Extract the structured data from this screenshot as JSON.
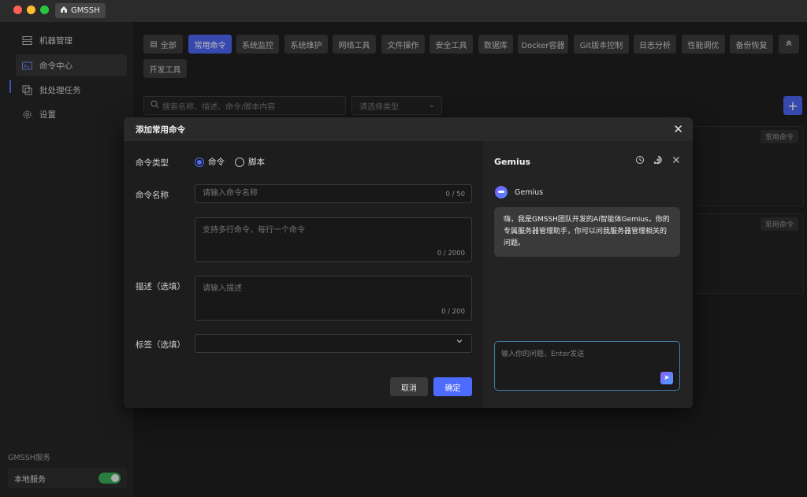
{
  "window": {
    "app_tab_label": "GMSSH"
  },
  "sidebar": {
    "items": [
      {
        "label": "机器管理",
        "icon": "server-icon"
      },
      {
        "label": "命令中心",
        "icon": "terminal-icon"
      },
      {
        "label": "批处理任务",
        "icon": "batch-icon"
      },
      {
        "label": "设置",
        "icon": "gear-icon"
      }
    ],
    "footer_label": "GMSSH服务",
    "local_service_label": "本地服务",
    "local_service_on": true
  },
  "tabs": [
    "全部",
    "常用命令",
    "系统监控",
    "系统维护",
    "网络工具",
    "文件操作",
    "安全工具",
    "数据库",
    "Docker容器",
    "Git版本控制",
    "日志分析",
    "性能调优",
    "备份恢复",
    "开发工具"
  ],
  "active_tab": "常用命令",
  "toolbar": {
    "search_placeholder": "搜索名称、描述、命令/脚本内容",
    "type_placeholder": "请选择类型",
    "card_tag": "常用命令"
  },
  "modal": {
    "title": "添加常用命令",
    "type_label": "命令类型",
    "type_options": [
      "命令",
      "脚本"
    ],
    "type_selected": "命令",
    "name_label": "命令名称",
    "name_placeholder": "请输入命令名称",
    "name_counter": "0 / 50",
    "command_placeholder": "支持多行命令，每行一个命令",
    "command_counter": "0 / 2000",
    "desc_label": "描述（选填）",
    "desc_placeholder": "请输入描述",
    "desc_counter": "0 / 200",
    "tags_label": "标签（选填）",
    "cancel_label": "取消",
    "confirm_label": "确定"
  },
  "assistant": {
    "title": "Gemius",
    "sender": "Gemius",
    "message": "嗨，我是GMSSH团队开发的Ai智能体Gemius，你的专属服务器管理助手，你可以问我服务器管理相关的问题。",
    "input_placeholder": "输入你的问题，Enter发送"
  },
  "colors": {
    "accent": "#4e6bff",
    "toggle_on": "#34a853"
  }
}
